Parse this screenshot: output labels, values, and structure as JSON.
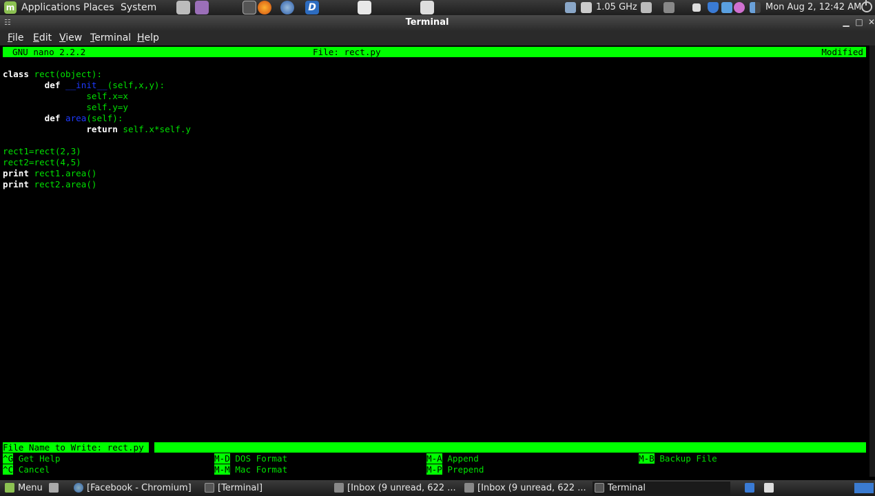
{
  "top_panel": {
    "menus": [
      "Applications",
      "Places",
      "System"
    ],
    "cpu_freq": "1.05 GHz",
    "clock": "Mon Aug  2, 12:42 AM",
    "launcher_icons": [
      "home-folder-icon",
      "ghost-icon",
      "terminal-icon",
      "firefox-icon",
      "thunderbird-icon",
      "deluge-icon",
      "text-editor-icon",
      "screenshot-icon"
    ],
    "tray_icons": [
      "network-icon",
      "battery-icon",
      "user-icon",
      "volume-icon",
      "stop-icon",
      "shield-icon",
      "bluetooth-icon",
      "settings-icon",
      "signal-icon"
    ]
  },
  "window": {
    "title": "Terminal",
    "menu": [
      "File",
      "Edit",
      "View",
      "Terminal",
      "Help"
    ]
  },
  "nano": {
    "version": "GNU nano 2.2.2",
    "file": "File: rect.py",
    "status": "Modified",
    "prompt": "File Name to Write: rect.py",
    "code_lines": [
      [
        {
          "t": "class",
          "c": "kw"
        },
        {
          "t": " rect(object):",
          "c": "tx"
        }
      ],
      [
        {
          "t": "        ",
          "c": "tx"
        },
        {
          "t": "def",
          "c": "kw"
        },
        {
          "t": " ",
          "c": "tx"
        },
        {
          "t": "__init__",
          "c": "fn"
        },
        {
          "t": "(self,x,y):",
          "c": "tx"
        }
      ],
      [
        {
          "t": "                self.x=x",
          "c": "tx"
        }
      ],
      [
        {
          "t": "                self.y=y",
          "c": "tx"
        }
      ],
      [
        {
          "t": "        ",
          "c": "tx"
        },
        {
          "t": "def",
          "c": "kw"
        },
        {
          "t": " ",
          "c": "tx"
        },
        {
          "t": "area",
          "c": "fn"
        },
        {
          "t": "(self):",
          "c": "tx"
        }
      ],
      [
        {
          "t": "                ",
          "c": "tx"
        },
        {
          "t": "return",
          "c": "kw"
        },
        {
          "t": " self.x*self.y",
          "c": "tx"
        }
      ],
      [],
      [
        {
          "t": "rect1=rect(2,3)",
          "c": "tx"
        }
      ],
      [
        {
          "t": "rect2=rect(4,5)",
          "c": "tx"
        }
      ],
      [
        {
          "t": "print",
          "c": "kw"
        },
        {
          "t": " rect1.area()",
          "c": "tx"
        }
      ],
      [
        {
          "t": "print",
          "c": "kw"
        },
        {
          "t": " rect2.area()",
          "c": "tx"
        }
      ]
    ],
    "shortcuts": [
      {
        "key": "^G",
        "label": "Get Help"
      },
      {
        "key": "M-D",
        "label": "DOS Format"
      },
      {
        "key": "M-A",
        "label": "Append"
      },
      {
        "key": "M-B",
        "label": "Backup File"
      },
      {
        "key": "^C",
        "label": "Cancel"
      },
      {
        "key": "M-M",
        "label": "Mac Format"
      },
      {
        "key": "M-P",
        "label": "Prepend"
      }
    ]
  },
  "taskbar": {
    "menu_label": "Menu",
    "tasks": [
      "[Facebook - Chromium]",
      "[Terminal]",
      "[Inbox (9 unread, 622 ...",
      "[Inbox (9 unread, 622 ...",
      "Terminal"
    ]
  },
  "colors": {
    "nano_green": "#00ff00",
    "code_green": "#00e000",
    "function_blue": "#1e3aff"
  }
}
